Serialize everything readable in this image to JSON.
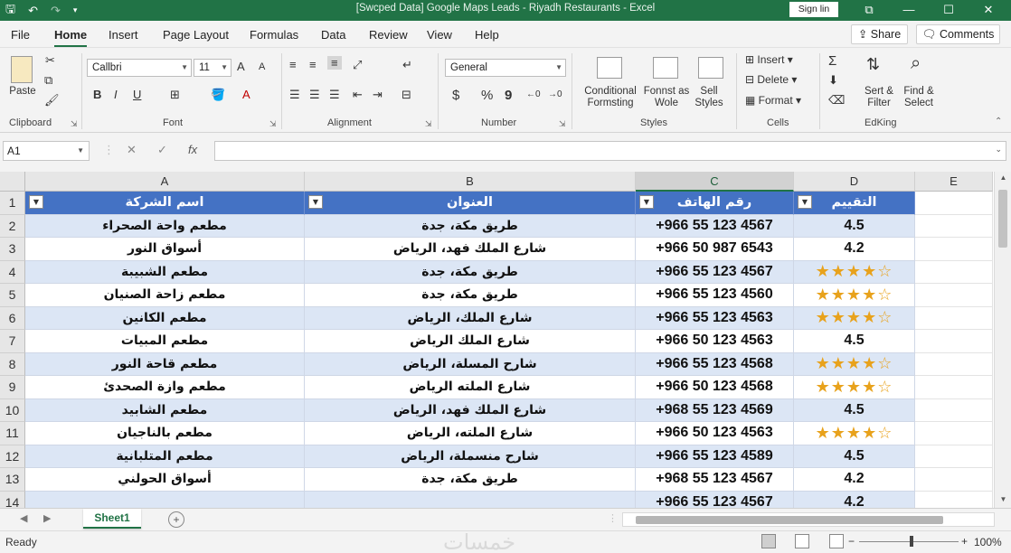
{
  "app": {
    "title": "[Swcped Data] Google Maps Leads - Riyadh Restaurants - Excel",
    "sign_in": "Sign lin",
    "accent_color": "#217346",
    "table_header_color": "#4472c4",
    "window_icons": [
      "restore-icon",
      "minimize-icon",
      "maximize-icon",
      "close-icon"
    ]
  },
  "ribbon_tabs": [
    "File",
    "Home",
    "Insert",
    "Page Layout",
    "Formulas",
    "Data",
    "Review",
    "View",
    "Help"
  ],
  "active_tab": "Home",
  "share_label": "Share",
  "comments_label": "Comments",
  "ribbon": {
    "clipboard": {
      "label": "Clipboard",
      "paste": "Paste"
    },
    "font": {
      "label": "Font",
      "font_name": "Callbri",
      "font_size": "11",
      "grow": "A",
      "shrink": "A",
      "bold": "B",
      "italic": "I",
      "underline": "U"
    },
    "alignment": {
      "label": "Alignment"
    },
    "number": {
      "label": "Number",
      "format": "General",
      "currency": "$",
      "percent": "%",
      "comma": "9"
    },
    "styles": {
      "label": "Styles",
      "conditional": "Conditional Formsting",
      "format_as": "Fonnst as Wole",
      "cell_styles": "Sell Styles"
    },
    "cells": {
      "label": "Cells",
      "insert": "Insert",
      "delete": "Delete",
      "format": "Format"
    },
    "editing": {
      "label": "EdKing",
      "sort": "Sert & Filter",
      "find": "Find & Select"
    }
  },
  "formula_bar": {
    "name_box": "A1",
    "cancel": "✕",
    "enter": "✓",
    "fx": "fx",
    "content": ""
  },
  "columns": [
    "A",
    "B",
    "C",
    "D",
    "E"
  ],
  "table": {
    "headers": [
      "اسم الشركة",
      "العنوان",
      "رقم الهاتف",
      "التقييم"
    ],
    "rows": [
      {
        "n": "2",
        "name": "مطعم واحة الصحراء",
        "addr": "طريق مكة، جدة",
        "phone": "+966 55 123 4567",
        "rating": "4.5"
      },
      {
        "n": "3",
        "name": "أسواق النور",
        "addr": "شارع الملك فهد، الرياض",
        "phone": "+966 50 987 6543",
        "rating": "4.2"
      },
      {
        "n": "4",
        "name": "مطعم الشبيبة",
        "addr": "طريق مكة، جدة",
        "phone": "+966 55 123 4567",
        "rating": "★★★★☆"
      },
      {
        "n": "5",
        "name": "مطعم زاحة الصنيان",
        "addr": "طريق مكة، جدة",
        "phone": "+966 55 123 4560",
        "rating": "★★★★☆"
      },
      {
        "n": "6",
        "name": "مطعم الكانين",
        "addr": "شارع الملك، الرياض",
        "phone": "+966 55 123 4563",
        "rating": "★★★★☆"
      },
      {
        "n": "7",
        "name": "مطعم المبيات",
        "addr": "شارع الملك الرياض",
        "phone": "+966 50 123 4563",
        "rating": "4.5"
      },
      {
        "n": "8",
        "name": "مطعم قاحة النور",
        "addr": "شارح المسلة، الرياض",
        "phone": "+966 55 123 4568",
        "rating": "★★★★☆"
      },
      {
        "n": "9",
        "name": "مطعم وازة الصحدئ",
        "addr": "شارع الملته الرياض",
        "phone": "+966 50 123 4568",
        "rating": "★★★★☆"
      },
      {
        "n": "10",
        "name": "مطعم الشابيد",
        "addr": "شارع الملك فهد، الرياض",
        "phone": "+968 55 123 4569",
        "rating": "4.5"
      },
      {
        "n": "11",
        "name": "مطعم بالناجيان",
        "addr": "شارع الملته، الرياض",
        "phone": "+966 50 123 4563",
        "rating": "★★★★☆"
      },
      {
        "n": "12",
        "name": "مطعم المتلبانية",
        "addr": "شارح منسملة، الرياض",
        "phone": "+966 55 123 4589",
        "rating": "4.5"
      },
      {
        "n": "13",
        "name": "أسواق الحولني",
        "addr": "طريق مكة، جدة",
        "phone": "+968 55 123 4567",
        "rating": "4.2"
      },
      {
        "n": "14",
        "name": "",
        "addr": "",
        "phone": "+966 55 123 4567",
        "rating": "4.2"
      }
    ]
  },
  "sheet_tab": "Sheet1",
  "status": {
    "ready": "Ready",
    "zoom": "100%",
    "watermark": "خمسات",
    "zoom_minus": "−",
    "zoom_plus": "+"
  }
}
